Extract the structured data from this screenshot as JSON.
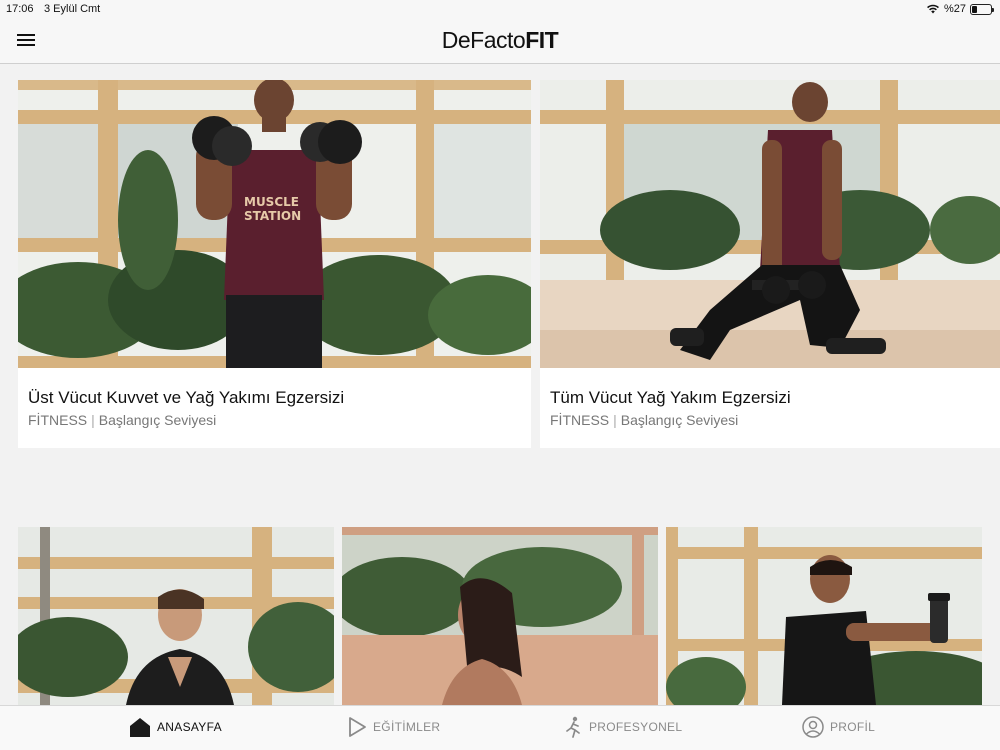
{
  "status_bar": {
    "time": "17:06",
    "date": "3 Eylül Cmt",
    "battery": "%27",
    "battery_level": 0.27
  },
  "header": {
    "logo_part1": "DeFacto",
    "logo_part2": "FIT",
    "menu_icon": "hamburger-menu-icon"
  },
  "featured": [
    {
      "title": "Üst Vücut Kuvvet ve Yağ Yakımı Egzersizi",
      "category": "FİTNESS",
      "separator": "|",
      "level": "Başlangıç Seviyesi"
    },
    {
      "title": "Tüm Vücut Yağ Yakım Egzersizi",
      "category": "FİTNESS",
      "separator": "|",
      "level": "Başlangıç Seviyesi"
    }
  ],
  "nav": {
    "home": "ANASAYFA",
    "trainings": "EĞİTİMLER",
    "professional": "PROFESYONEL",
    "profile": "PROFİL",
    "active": "home"
  },
  "colors": {
    "background": "#f2f2f2",
    "card": "#ffffff",
    "text": "#111111",
    "muted": "#777777"
  }
}
